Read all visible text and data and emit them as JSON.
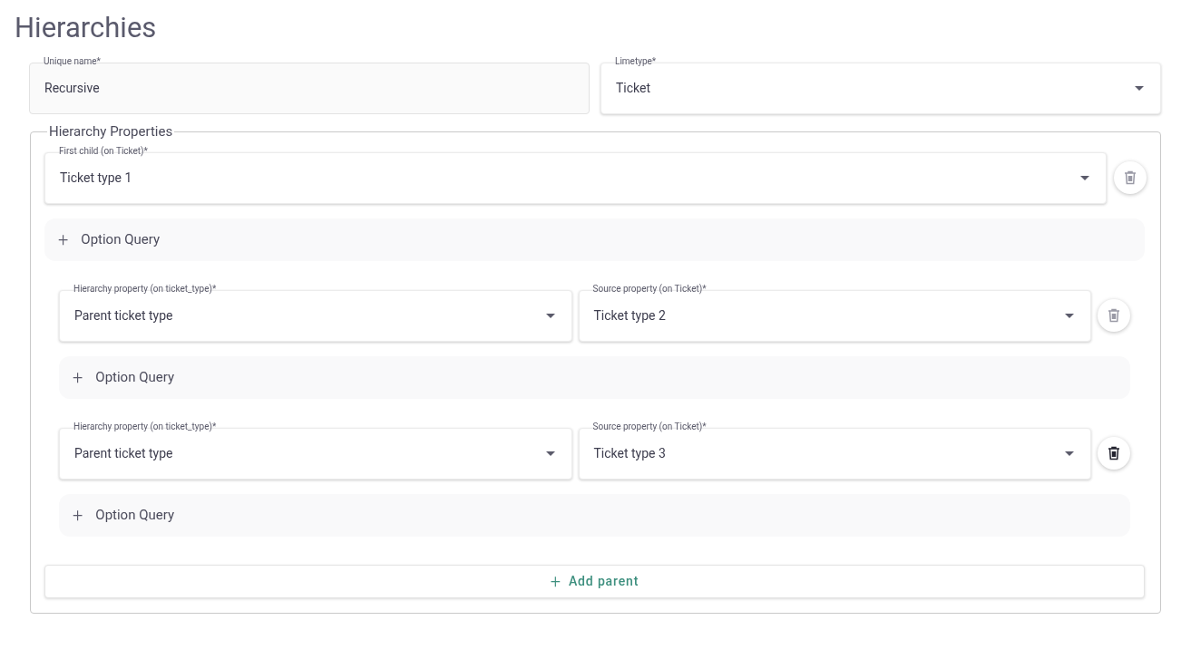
{
  "title": "Hierarchies",
  "top_fields": [
    {
      "kind": "text",
      "label": "Unique name*",
      "value": "Recursive"
    },
    {
      "kind": "select",
      "label": "Limetype*",
      "value": "Ticket"
    }
  ],
  "hierarchy_properties": {
    "legend": "Hierarchy Properties",
    "first_child": {
      "field": {
        "kind": "select",
        "label": "First child (on Ticket)*",
        "value": "Ticket type 1"
      },
      "delete_disabled": true,
      "option_query": {
        "icon": "+",
        "label": "Option Query"
      }
    },
    "parents": [
      {
        "fields": [
          {
            "kind": "select",
            "label": "Hierarchy property (on ticket_type)*",
            "value": "Parent ticket type"
          },
          {
            "kind": "select",
            "label": "Source property (on Ticket)*",
            "value": "Ticket type 2"
          }
        ],
        "delete_disabled": true,
        "option_query": {
          "icon": "+",
          "label": "Option Query"
        }
      },
      {
        "fields": [
          {
            "kind": "select",
            "label": "Hierarchy property (on ticket_type)*",
            "value": "Parent ticket type"
          },
          {
            "kind": "select",
            "label": "Source property (on Ticket)*",
            "value": "Ticket type 3"
          }
        ],
        "delete_disabled": false,
        "option_query": {
          "icon": "+",
          "label": "Option Query"
        }
      }
    ],
    "add_button": {
      "icon": "+",
      "label": "Add parent"
    }
  }
}
